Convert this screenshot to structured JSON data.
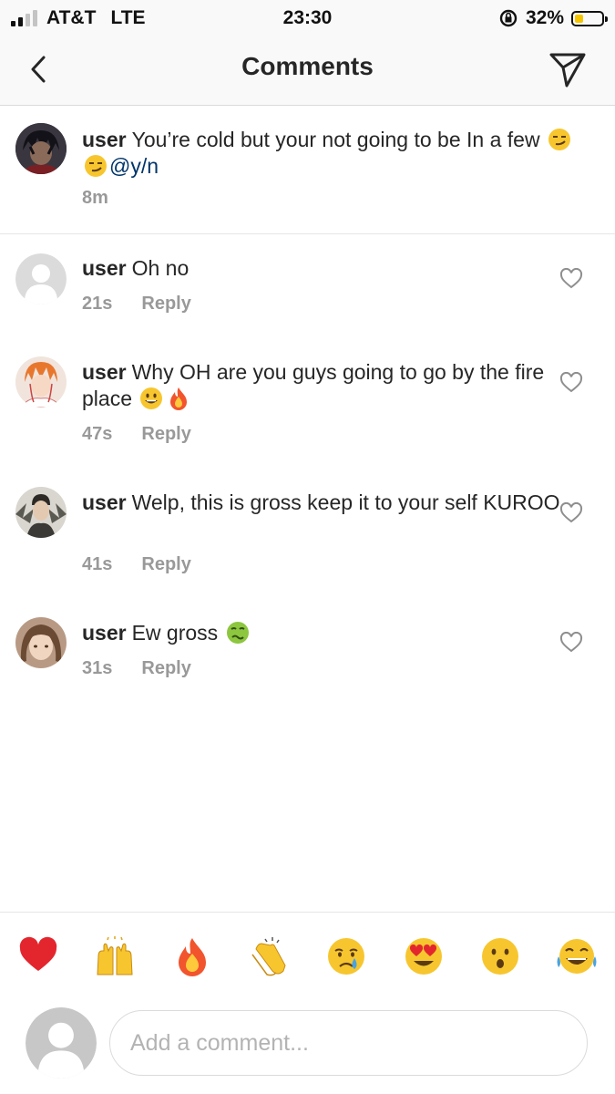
{
  "status_bar": {
    "carrier": "AT&T",
    "network": "LTE",
    "time": "23:30",
    "battery_percent": "32%",
    "battery_level": 0.32
  },
  "header": {
    "title": "Comments",
    "back_icon": "chevron-left-icon",
    "send_icon": "direct-send-icon"
  },
  "caption": {
    "username": "user",
    "text": "You’re cold but your not going to be In a few",
    "emojis": [
      "smirk",
      "smirk"
    ],
    "mention": "@y/n",
    "time": "8m"
  },
  "comments": [
    {
      "username": "user",
      "text": "Oh no",
      "time": "21s",
      "reply": "Reply"
    },
    {
      "username": "user",
      "text": "Why OH are you guys going to go by the fire place",
      "emojis": [
        "grinning",
        "fire"
      ],
      "time": "47s",
      "reply": "Reply"
    },
    {
      "username": "user",
      "text": "Welp, this is gross keep it to your self KUROO",
      "time": "41s",
      "reply": "Reply"
    },
    {
      "username": "user",
      "text": "Ew gross",
      "emojis": [
        "nauseated"
      ],
      "time": "31s",
      "reply": "Reply"
    }
  ],
  "quick_reactions": [
    "red-heart",
    "raising-hands",
    "fire",
    "clapping-hands",
    "crying-face",
    "heart-eyes",
    "hushed-face",
    "tears-of-joy"
  ],
  "input": {
    "placeholder": "Add a comment..."
  },
  "colors": {
    "mention": "#003569",
    "meta": "#999999",
    "battery": "#f5c400"
  }
}
